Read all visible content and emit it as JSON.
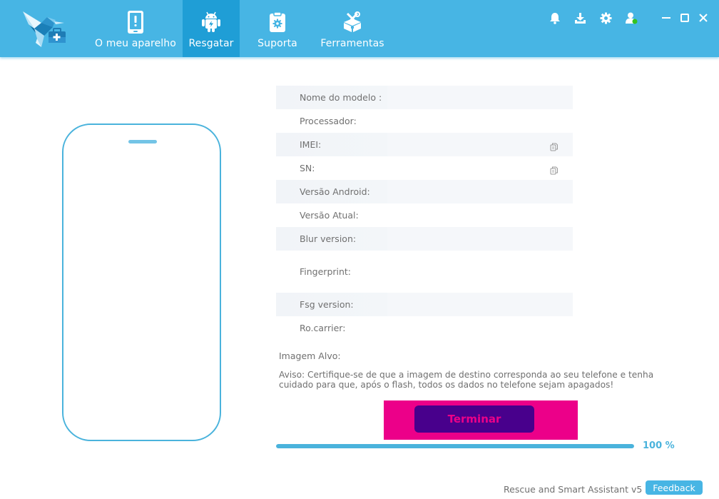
{
  "app": {
    "name": "Rescue and Smart Assistant v5",
    "accent_color": "#47b5e4",
    "active_tab_color": "#1f9ed6"
  },
  "nav": {
    "items": [
      {
        "label": "O meu aparelho",
        "icon": "phone-alert-icon",
        "active": false
      },
      {
        "label": "Resgatar",
        "icon": "android-icon",
        "active": true
      },
      {
        "label": "Suporta",
        "icon": "clipboard-gear-icon",
        "active": false
      },
      {
        "label": "Ferramentas",
        "icon": "toolbox-icon",
        "active": false
      }
    ]
  },
  "header_icons": [
    "bell-icon",
    "download-icon",
    "gear-icon",
    "user-online-icon"
  ],
  "window_controls": [
    "minimize-icon",
    "maximize-icon",
    "close-icon"
  ],
  "device_info": {
    "rows": [
      {
        "label": "Nome do modelo :",
        "value": ""
      },
      {
        "label": "Processador:",
        "value": ""
      },
      {
        "label": "IMEI:",
        "value": "",
        "copyable": true
      },
      {
        "label": "SN:",
        "value": "",
        "copyable": true
      },
      {
        "label": "Versão Android:",
        "value": ""
      },
      {
        "label": "Versão Atual:",
        "value": ""
      },
      {
        "label": "Blur version:",
        "value": ""
      },
      {
        "label": "Fingerprint:",
        "value": ""
      },
      {
        "label": "Fsg version:",
        "value": ""
      },
      {
        "label": "Ro.carrier:",
        "value": ""
      }
    ]
  },
  "target_image": {
    "label": "Imagem Alvo:",
    "value": ""
  },
  "warning": "Aviso: Certifique-se de que a imagem de destino corresponda ao seu telefone e tenha cuidado para que, após o flash, todos os dados no telefone sejam apagados!",
  "finish_button": {
    "label": "Terminar",
    "bg_color": "#48008c",
    "text_color": "#ec0089",
    "highlight_color": "#ec0089"
  },
  "progress": {
    "percent": 100,
    "text": "100 %"
  },
  "footer": {
    "app_version": "Rescue and Smart Assistant v5",
    "feedback_label": "Feedback"
  }
}
